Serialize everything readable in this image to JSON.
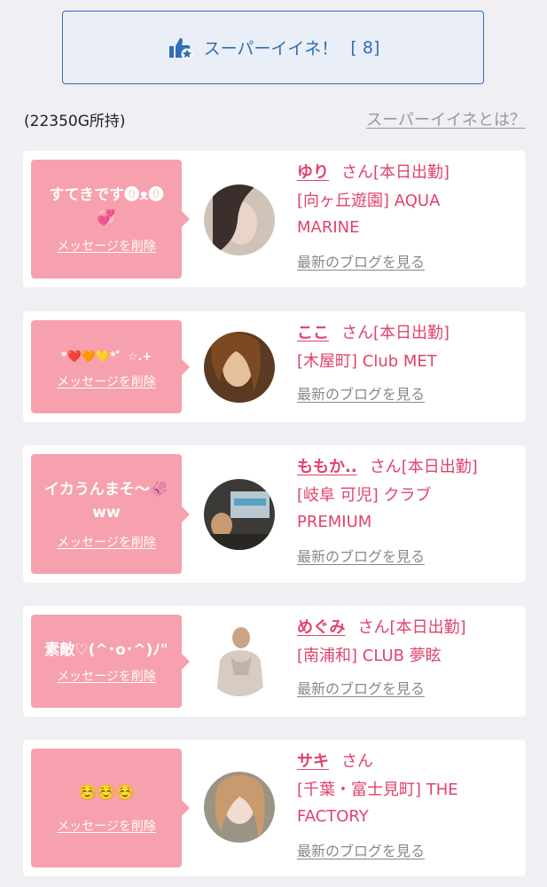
{
  "super_like": {
    "label": "スーパーイイネ！",
    "count": "[ 8]",
    "icon": "thumbs-up-star-icon",
    "color": "#2f6fb5"
  },
  "held_points": "(22350G所持)",
  "about_link": "スーパーイイネとは？",
  "delete_label": "メッセージを削除",
  "blog_label": "最新のブログを見る",
  "suffix_san": "さん",
  "status_today": "[本日出勤]",
  "accent_color": "#e0436a",
  "bubble_color": "#f6a1ad",
  "cards": [
    {
      "message": "すてきです⓿ᴥ⓿",
      "message_emoji": "💞",
      "name": "ゆり",
      "status": "[本日出勤]",
      "shop_line1": "[向ヶ丘遊園] AQUA",
      "shop_line2": "MARINE"
    },
    {
      "message": "*❤️🧡💛*゜☆.+",
      "name": "ここ",
      "status": "[本日出勤]",
      "shop_line1": "[木屋町] Club MET",
      "shop_line2": ""
    },
    {
      "message": "イカうんまそ〜🦑",
      "message_line2": "ww",
      "name": "ももか..",
      "status": "[本日出勤]",
      "shop_line1": "[岐阜 可児] クラブ",
      "shop_line2": "PREMIUM"
    },
    {
      "message": "素敵♡(^･o･^)ﾉ\"",
      "name": "めぐみ",
      "status": "[本日出勤]",
      "shop_line1": "[南浦和] CLUB 夢眩",
      "shop_line2": ""
    },
    {
      "message": "☺️☺️☺️",
      "name": "サキ",
      "status": "",
      "shop_line1": "[千葉・富士見町] THE",
      "shop_line2": "FACTORY"
    }
  ]
}
